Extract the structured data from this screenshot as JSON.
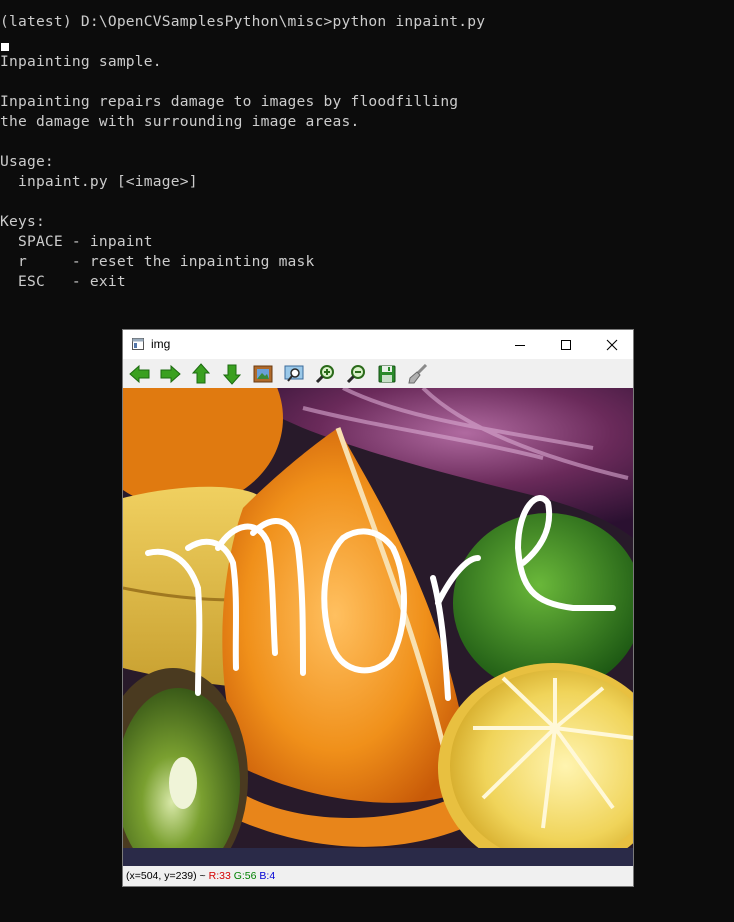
{
  "console": {
    "lines": [
      "(latest) D:\\OpenCVSamplesPython\\misc>python inpaint.py",
      "",
      "Inpainting sample.",
      "",
      "Inpainting repairs damage to images by floodfilling",
      "the damage with surrounding image areas.",
      "",
      "Usage:",
      "  inpaint.py [<image>]",
      "",
      "Keys:",
      "  SPACE - inpaint",
      "  r     - reset the inpainting mask",
      "  ESC   - exit"
    ],
    "text_color": "#cccccc",
    "background": "#0c0c0c"
  },
  "window": {
    "title": "img",
    "controls": {
      "minimize_icon": "minimize-icon",
      "maximize_icon": "maximize-icon",
      "close_icon": "close-icon"
    },
    "toolbar": [
      {
        "name": "pan-left-button",
        "icon": "arrow-left-icon"
      },
      {
        "name": "pan-right-button",
        "icon": "arrow-right-icon"
      },
      {
        "name": "pan-up-button",
        "icon": "arrow-up-icon"
      },
      {
        "name": "pan-down-button",
        "icon": "arrow-down-icon"
      },
      {
        "name": "zoom-original-button",
        "icon": "image-icon"
      },
      {
        "name": "zoom-fit-button",
        "icon": "zoom-window-icon"
      },
      {
        "name": "zoom-in-button",
        "icon": "zoom-in-icon"
      },
      {
        "name": "zoom-out-button",
        "icon": "zoom-out-icon"
      },
      {
        "name": "save-button",
        "icon": "save-icon"
      },
      {
        "name": "properties-button",
        "icon": "brush-icon"
      }
    ],
    "image": {
      "description_icon": "fruit-photo",
      "mask_stroke_color": "#ffffff"
    },
    "status": {
      "coords": "(x=504, y=239) ~",
      "r": "R:33",
      "g": "G:56",
      "b": "B:4",
      "r_color": "#d40000",
      "g_color": "#008000",
      "b_color": "#0000d4"
    }
  }
}
